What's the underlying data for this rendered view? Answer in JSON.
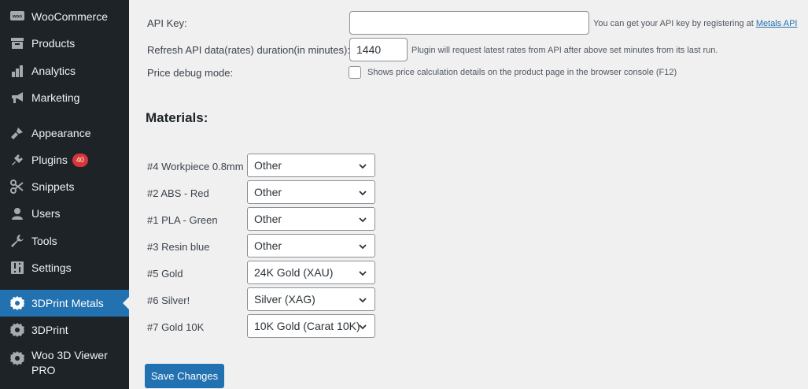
{
  "sidebar": {
    "items": [
      {
        "label": "WooCommerce",
        "icon": "woocommerce-icon"
      },
      {
        "label": "Products",
        "icon": "archive-icon"
      },
      {
        "label": "Analytics",
        "icon": "bar-chart-icon"
      },
      {
        "label": "Marketing",
        "icon": "megaphone-icon"
      },
      {
        "label": "Appearance",
        "icon": "paintbrush-icon"
      },
      {
        "label": "Plugins",
        "icon": "plug-icon",
        "badge": "40"
      },
      {
        "label": "Snippets",
        "icon": "scissors-icon"
      },
      {
        "label": "Users",
        "icon": "user-icon"
      },
      {
        "label": "Tools",
        "icon": "wrench-icon"
      },
      {
        "label": "Settings",
        "icon": "sliders-icon"
      },
      {
        "label": "3DPrint Metals",
        "icon": "gear-icon",
        "active": true
      },
      {
        "label": "3DPrint",
        "icon": "gear-icon"
      },
      {
        "label": "Woo 3D Viewer PRO",
        "icon": "gear-icon"
      }
    ]
  },
  "settings": {
    "api_key": {
      "label": "API Key:",
      "value": "",
      "desc": "You can get your API key by registering at",
      "link": "Metals API"
    },
    "refresh": {
      "label": "Refresh API data(rates) duration(in minutes):",
      "value": "1440",
      "desc": "Plugin will request latest rates from API after above set minutes from its last run."
    },
    "debug": {
      "label": "Price debug mode:",
      "checked": false,
      "desc": "Shows price calculation details on the product page in the browser console (F12)"
    }
  },
  "materials": {
    "heading": "Materials:",
    "rows": [
      {
        "name": "#4 Workpiece 0.8mm",
        "value": "Other"
      },
      {
        "name": "#2 ABS - Red",
        "value": "Other"
      },
      {
        "name": "#1 PLA - Green",
        "value": "Other"
      },
      {
        "name": "#3 Resin blue",
        "value": "Other"
      },
      {
        "name": "#5 Gold",
        "value": "24K Gold (XAU)"
      },
      {
        "name": "#6 Silver!",
        "value": "Silver (XAG)"
      },
      {
        "name": "#7 Gold 10K",
        "value": "10K Gold (Carat 10K)"
      }
    ]
  },
  "save_button": "Save Changes",
  "colors": {
    "sidebar": "#1d2327",
    "accent": "#2271b1",
    "badge": "#d63638",
    "background": "#f0f0f1"
  }
}
